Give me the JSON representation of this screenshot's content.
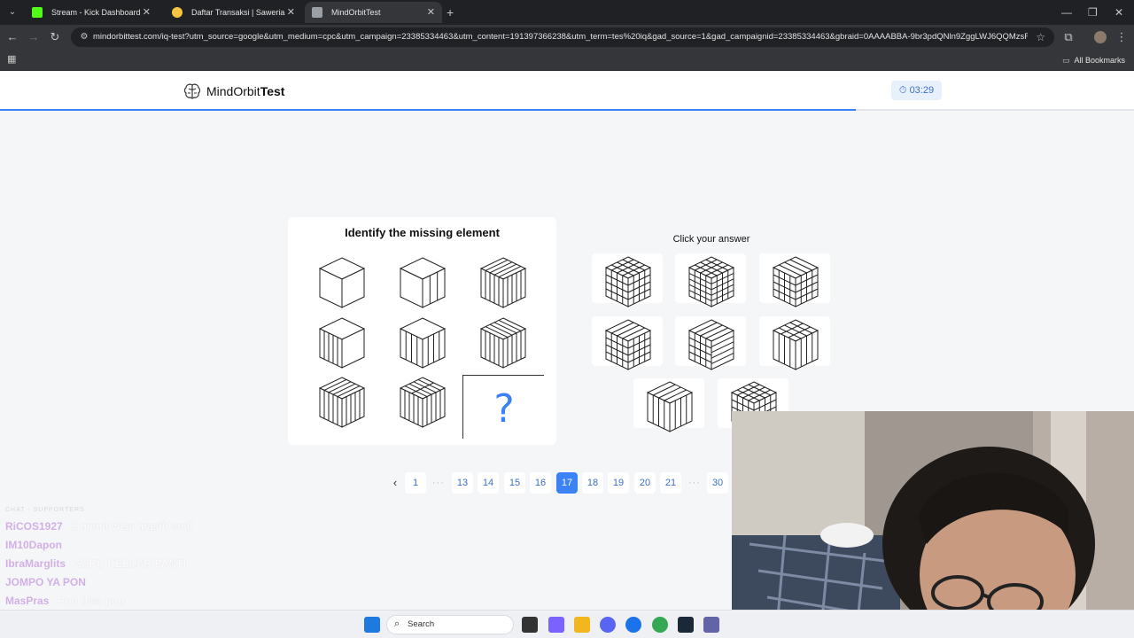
{
  "browser": {
    "tabs": [
      {
        "label": "Stream - Kick Dashboard",
        "favicon_color": "#53fc18",
        "active": false
      },
      {
        "label": "Daftar Transaksi | Saweria",
        "favicon_color": "#f5c542",
        "active": false
      },
      {
        "label": "MindOrbitTest",
        "favicon_color": "#9aa0a6",
        "active": true
      }
    ],
    "url": "mindorbittest.com/iq-test?utm_source=google&utm_medium=cpc&utm_campaign=23385334463&utm_content=191397366238&utm_term=tes%20iq&gad_source=1&gad_campaignid=23385334463&gbraid=0AAAABBA-9br3pdQNln9ZggLWJ6QQMzsR...",
    "bookmarks_label": "All Bookmarks"
  },
  "app": {
    "logo_prefix": "MindOrbit",
    "logo_bold": "Test",
    "timer": "03:29",
    "progress_fraction": 0.755
  },
  "question": {
    "title": "Identify the missing element",
    "missing_symbol": "?"
  },
  "answers": {
    "title": "Click your answer",
    "count": 8
  },
  "pagination": {
    "pages": [
      "1",
      "...",
      "13",
      "14",
      "15",
      "16",
      "17",
      "18",
      "19",
      "20",
      "21",
      "...",
      "30"
    ],
    "current": "17",
    "prev_icon": "‹"
  },
  "chat": {
    "header": "CHAT - SUPPORTERS",
    "lines": [
      {
        "user": "RiCOS1927",
        "message": "5 menit wisa masih soal"
      },
      {
        "user": "IM10Dapon",
        "message": ""
      },
      {
        "user": "IbraMarglits",
        "message": "SARU KELUAR PANTI"
      },
      {
        "user": "JOMPO YA PON",
        "message": ""
      },
      {
        "user": "MasPras",
        "message": "Pon bisa pon"
      },
      {
        "user": "IbraMarglits",
        "message": ""
      }
    ]
  },
  "taskbar": {
    "search_label": "Search",
    "icons": [
      {
        "name": "windows-start-icon",
        "color": "#1f7ae0"
      },
      {
        "name": "file-explorer-icon",
        "color": "#333333"
      },
      {
        "name": "copilot-icon",
        "color": "#7b61ff"
      },
      {
        "name": "folder-icon",
        "color": "#f2b61e"
      },
      {
        "name": "discord-icon",
        "color": "#5865f2"
      },
      {
        "name": "chrome-icon",
        "color": "#1a73e8"
      },
      {
        "name": "chrome-profile-icon",
        "color": "#34a853"
      },
      {
        "name": "steam-icon",
        "color": "#1b2838"
      },
      {
        "name": "teams-icon",
        "color": "#6264a7"
      }
    ]
  }
}
